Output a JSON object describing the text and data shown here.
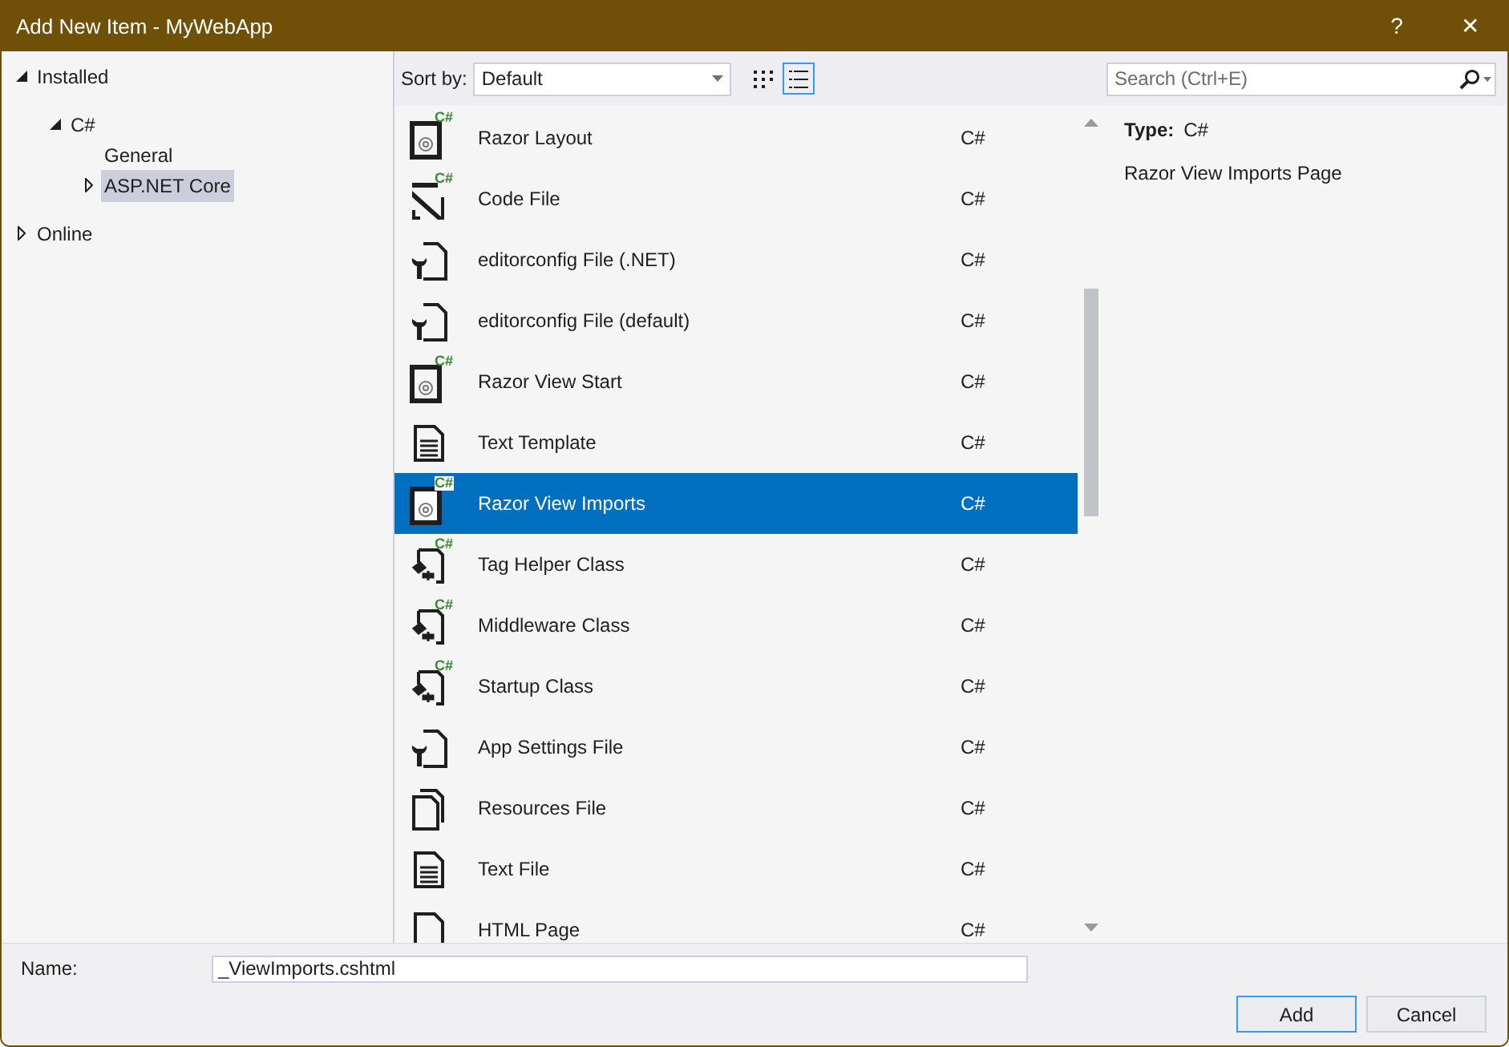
{
  "window": {
    "title": "Add New Item - MyWebApp",
    "help": "?",
    "close": "✕"
  },
  "tree": [
    {
      "label": "Installed",
      "expanded": true,
      "selected": false,
      "children": [
        {
          "label": "C#",
          "expanded": true,
          "selected": false,
          "children": [
            {
              "label": "General",
              "selected": false
            },
            {
              "label": "ASP.NET Core",
              "expanded": false,
              "selected": true
            }
          ]
        }
      ]
    },
    {
      "label": "Online",
      "expanded": false,
      "selected": false
    }
  ],
  "sort": {
    "label": "Sort by:",
    "value": "Default"
  },
  "view_modes": [
    {
      "kind": "grid",
      "selected": false
    },
    {
      "kind": "list",
      "selected": true
    }
  ],
  "search": {
    "placeholder": "Search (Ctrl+E)"
  },
  "templates": [
    {
      "name": "Razor Layout",
      "language": "C#",
      "kind": "razor",
      "badge": "C#",
      "selected": false
    },
    {
      "name": "Code File",
      "language": "C#",
      "kind": "code",
      "badge": "C#",
      "selected": false
    },
    {
      "name": "editorconfig File (.NET)",
      "language": "C#",
      "kind": "config",
      "selected": false
    },
    {
      "name": "editorconfig File (default)",
      "language": "C#",
      "kind": "config",
      "selected": false
    },
    {
      "name": "Razor View Start",
      "language": "C#",
      "kind": "razor",
      "badge": "C#",
      "selected": false
    },
    {
      "name": "Text Template",
      "language": "C#",
      "kind": "text",
      "selected": false
    },
    {
      "name": "Razor View Imports",
      "language": "C#",
      "kind": "razor",
      "badge": "C#",
      "selected": true
    },
    {
      "name": "Tag Helper Class",
      "language": "C#",
      "kind": "class",
      "badge": "C#",
      "selected": false
    },
    {
      "name": "Middleware Class",
      "language": "C#",
      "kind": "class",
      "badge": "C#",
      "selected": false
    },
    {
      "name": "Startup Class",
      "language": "C#",
      "kind": "class",
      "badge": "C#",
      "selected": false
    },
    {
      "name": "App Settings File",
      "language": "C#",
      "kind": "config",
      "selected": false
    },
    {
      "name": "Resources File",
      "language": "C#",
      "kind": "resources",
      "selected": false
    },
    {
      "name": "Text File",
      "language": "C#",
      "kind": "text",
      "selected": false
    },
    {
      "name": "HTML Page",
      "language": "C#",
      "kind": "html",
      "selected": false
    }
  ],
  "details": {
    "type_label": "Type:",
    "type_value": "C#",
    "description": "Razor View Imports Page"
  },
  "name_field": {
    "label": "Name:",
    "value": "_ViewImports.cshtml"
  },
  "buttons": [
    {
      "label": "Add",
      "default": true
    },
    {
      "label": "Cancel",
      "default": false
    }
  ]
}
